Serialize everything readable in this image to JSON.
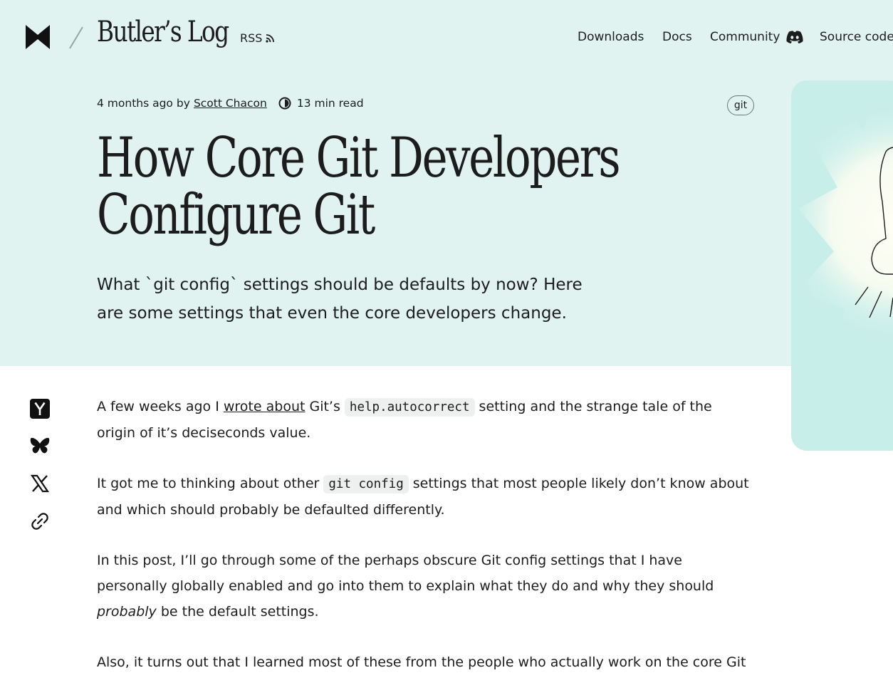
{
  "header": {
    "site_title": "Butler’s Log",
    "rss_label": "RSS",
    "nav": {
      "downloads": "Downloads",
      "docs": "Docs",
      "community": "Community",
      "source": "Source code"
    }
  },
  "post": {
    "time_ago": "4 months ago",
    "by": "by",
    "author": "Scott Chacon",
    "read_time": "13 min read",
    "tag": "git",
    "title": "How Core Git Developers Configure Git",
    "subtitle": "What `git config` settings should be defaults by now? Here are some settings that even the core developers change."
  },
  "article": {
    "p1": {
      "a": "A few weeks ago I ",
      "link": "wrote about",
      "b": " Git’s ",
      "code": "help.autocorrect",
      "c": " setting and the strange tale of the origin of it’s deciseconds value."
    },
    "p2": {
      "a": "It got me to thinking about other ",
      "code": "git config",
      "b": " settings that most people likely don’t know about and which should probably be defaulted differently."
    },
    "p3": {
      "a": "In this post, I’ll go through some of the perhaps obscure Git config settings that I have personally globally enabled and go into them to explain what they do and why they should ",
      "em": "probably",
      "b": " be the default settings."
    },
    "p4": {
      "a": "Also, it turns out that I learned most of these from the people who actually work on the core Git"
    }
  },
  "share": [
    "hacker-news-icon",
    "bluesky-icon",
    "x-icon",
    "link-icon"
  ],
  "colors": {
    "hero_background": "#e0f3f1",
    "card_background": "#c8eeea",
    "text": "#1c1c1c",
    "code_background": "#eef0ef"
  }
}
